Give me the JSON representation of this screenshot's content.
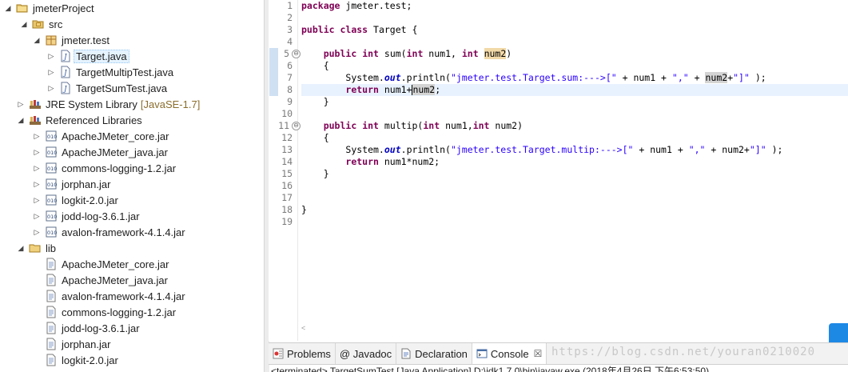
{
  "explorer": {
    "items": [
      {
        "label": "jmeterProject",
        "suffix": "",
        "icon": "project-icon",
        "twisty": "open"
      },
      {
        "label": "src",
        "suffix": "",
        "icon": "source-folder-icon",
        "twisty": "open"
      },
      {
        "label": "jmeter.test",
        "suffix": "",
        "icon": "package-icon",
        "twisty": "open"
      },
      {
        "label": "Target.java",
        "suffix": "",
        "icon": "java-file-icon",
        "twisty": "closed"
      },
      {
        "label": "TargetMultipTest.java",
        "suffix": "",
        "icon": "java-file-icon",
        "twisty": "closed"
      },
      {
        "label": "TargetSumTest.java",
        "suffix": "",
        "icon": "java-file-icon",
        "twisty": "closed"
      },
      {
        "label": "JRE System Library",
        "suffix": "[JavaSE-1.7]",
        "icon": "library-icon",
        "twisty": "closed"
      },
      {
        "label": "Referenced Libraries",
        "suffix": "",
        "icon": "library-icon",
        "twisty": "open"
      },
      {
        "label": "ApacheJMeter_core.jar",
        "suffix": "",
        "icon": "jar-icon",
        "twisty": "closed"
      },
      {
        "label": "ApacheJMeter_java.jar",
        "suffix": "",
        "icon": "jar-icon",
        "twisty": "closed"
      },
      {
        "label": "commons-logging-1.2.jar",
        "suffix": "",
        "icon": "jar-icon",
        "twisty": "closed"
      },
      {
        "label": "jorphan.jar",
        "suffix": "",
        "icon": "jar-icon",
        "twisty": "closed"
      },
      {
        "label": "logkit-2.0.jar",
        "suffix": "",
        "icon": "jar-icon",
        "twisty": "closed"
      },
      {
        "label": "jodd-log-3.6.1.jar",
        "suffix": "",
        "icon": "jar-icon",
        "twisty": "closed"
      },
      {
        "label": "avalon-framework-4.1.4.jar",
        "suffix": "",
        "icon": "jar-icon",
        "twisty": "closed"
      },
      {
        "label": "lib",
        "suffix": "",
        "icon": "folder-icon",
        "twisty": "open"
      },
      {
        "label": "ApacheJMeter_core.jar",
        "suffix": "",
        "icon": "jar-file-icon",
        "twisty": "none"
      },
      {
        "label": "ApacheJMeter_java.jar",
        "suffix": "",
        "icon": "jar-file-icon",
        "twisty": "none"
      },
      {
        "label": "avalon-framework-4.1.4.jar",
        "suffix": "",
        "icon": "jar-file-icon",
        "twisty": "none"
      },
      {
        "label": "commons-logging-1.2.jar",
        "suffix": "",
        "icon": "jar-file-icon",
        "twisty": "none"
      },
      {
        "label": "jodd-log-3.6.1.jar",
        "suffix": "",
        "icon": "jar-file-icon",
        "twisty": "none"
      },
      {
        "label": "jorphan.jar",
        "suffix": "",
        "icon": "jar-file-icon",
        "twisty": "none"
      },
      {
        "label": "logkit-2.0.jar",
        "suffix": "",
        "icon": "jar-file-icon",
        "twisty": "none"
      }
    ]
  },
  "editor": {
    "line_numbers": [
      "1",
      "2",
      "3",
      "4",
      "5",
      "6",
      "7",
      "8",
      "9",
      "10",
      "11",
      "12",
      "13",
      "14",
      "15",
      "16",
      "17",
      "18",
      "19"
    ],
    "lines": {
      "l1_kw": "package",
      "l1_rest": " jmeter.test;",
      "l3_kw1": "public",
      "l3_kw2": "class",
      "l3_rest": " Target {",
      "l5_kw1": "public",
      "l5_kw2": "int",
      "l5_mid": " sum(",
      "l5_kw3": "int",
      "l5_mid2": " num1, ",
      "l5_kw4": "int",
      "l5_param": "num2",
      "l5_end": ")",
      "l6": "{",
      "l7_pre": "System.",
      "l7_field": "out",
      "l7_mid": ".println(",
      "l7_str1": "\"jmeter.test.Target.sum:--->[\"",
      "l7_mid2": " + num1 + ",
      "l7_str2": "\",\"",
      "l7_mid3": " + ",
      "l7_var": "num2",
      "l7_mid4": "+",
      "l7_str3": "\"]\"",
      "l7_end": " );",
      "l8_kw": "return",
      "l8_a": " num1+",
      "l8_var": "num2",
      "l8_end": ";",
      "l9": "}",
      "l11_kw1": "public",
      "l11_kw2": "int",
      "l11_mid": " multip(",
      "l11_kw3": "int",
      "l11_mid2": " num1,",
      "l11_kw4": "int",
      "l11_end": " num2)",
      "l12": "{",
      "l13_pre": "System.",
      "l13_field": "out",
      "l13_mid": ".println(",
      "l13_str1": "\"jmeter.test.Target.multip:--->[\"",
      "l13_mid2": " + num1 + ",
      "l13_str2": "\",\"",
      "l13_mid3": " + num2+",
      "l13_str3": "\"]\"",
      "l13_end": " );",
      "l14_kw": "return",
      "l14_rest": " num1*num2;",
      "l15": "}",
      "l18": "}"
    },
    "fold_markers": [
      "⊖",
      "⊖"
    ],
    "hscroll_arrow": "<"
  },
  "panel": {
    "tabs": [
      {
        "label": "Problems",
        "icon": "problems-icon"
      },
      {
        "label": "@ Javadoc",
        "icon": "javadoc-icon"
      },
      {
        "label": "Declaration",
        "icon": "declaration-icon"
      },
      {
        "label": "Console",
        "icon": "console-icon",
        "close": "☒"
      }
    ],
    "watermark": "https://blog.csdn.net/youran0210020",
    "console_status": "<terminated> TargetSumTest [Java Application] D:\\jdk1.7.0\\bin\\javaw.exe (2018年4月26日 下午6:53:50)"
  }
}
